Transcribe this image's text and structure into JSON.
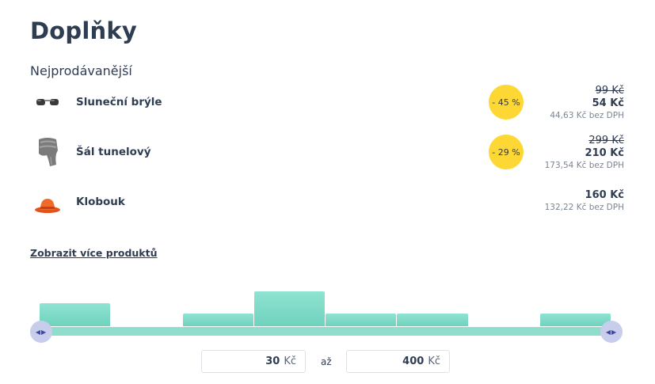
{
  "page": {
    "title": "Doplňky",
    "section_title": "Nejprodávanější"
  },
  "products": [
    {
      "name": "Sluneční brýle",
      "discount": "- 45 %",
      "old_price": "99 Kč",
      "price": "54 Kč",
      "net_price": "44,63 Kč bez DPH",
      "icon": "sunglasses-icon"
    },
    {
      "name": "Šál tunelový",
      "discount": "- 29 %",
      "old_price": "299 Kč",
      "price": "210 Kč",
      "net_price": "173,54 Kč bez DPH",
      "icon": "scarf-icon"
    },
    {
      "name": "Klobouk",
      "price": "160 Kč",
      "net_price": "132,22 Kč bez DPH",
      "icon": "hat-icon"
    }
  ],
  "more_link": "Zobrazit více produktů",
  "price_filter": {
    "min_value": "30",
    "max_value": "400",
    "currency": "Kč",
    "to_label": "až",
    "histogram": [
      0.55,
      0,
      0.3,
      0.85,
      0.3,
      0.3,
      0,
      0.3
    ],
    "colors": {
      "bar": "#7fd9c6",
      "track": "#8fddcc",
      "handle": "#c9cdec",
      "badge": "#fdd835"
    }
  }
}
